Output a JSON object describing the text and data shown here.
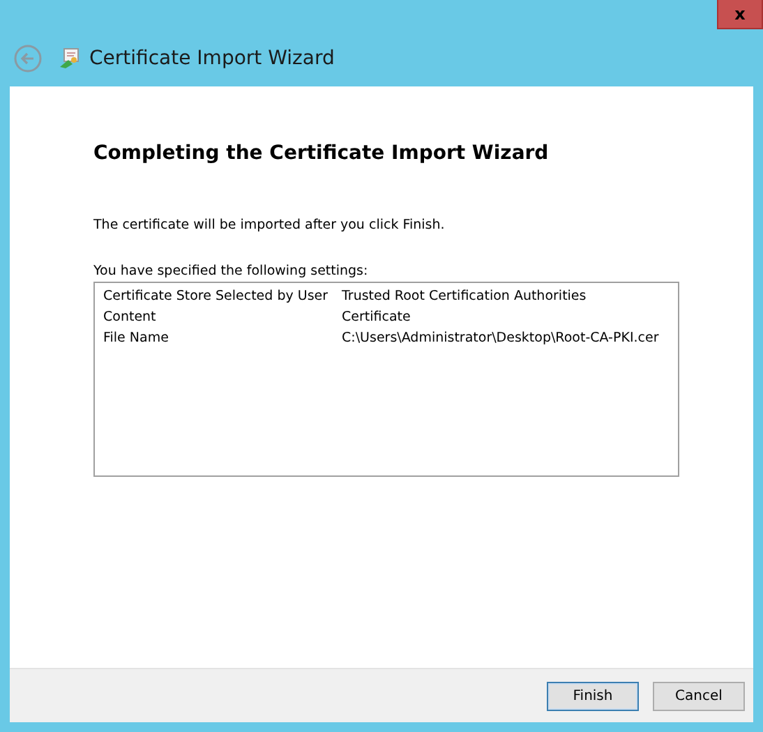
{
  "window": {
    "close": "x"
  },
  "wizard": {
    "title": "Certificate Import Wizard"
  },
  "page": {
    "heading": "Completing the Certificate Import Wizard",
    "intro": "The certificate will be imported after you click Finish.",
    "settings_label": "You have specified the following settings:"
  },
  "settings": [
    {
      "name": "Certificate Store Selected by User",
      "value": "Trusted Root Certification Authorities"
    },
    {
      "name": "Content",
      "value": "Certificate"
    },
    {
      "name": "File Name",
      "value": "C:\\Users\\Administrator\\Desktop\\Root-CA-PKI.cer"
    }
  ],
  "buttons": [
    {
      "label": "Finish",
      "default": true
    },
    {
      "label": "Cancel",
      "default": false
    }
  ]
}
